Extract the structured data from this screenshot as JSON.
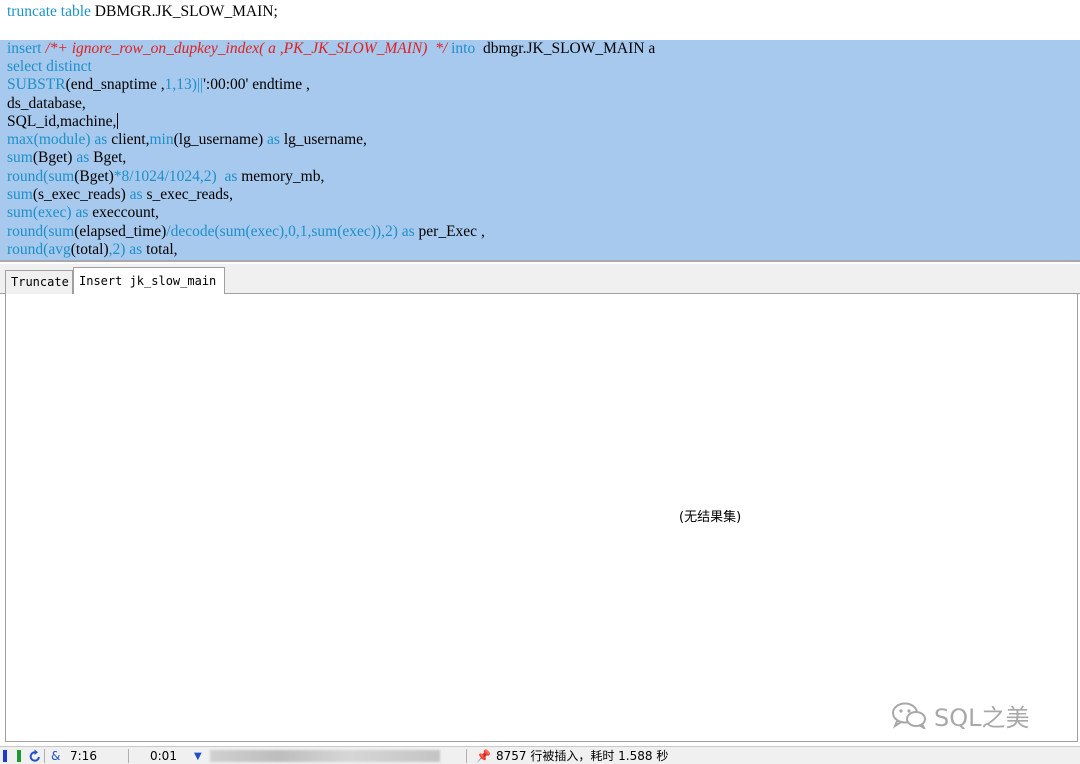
{
  "editor": {
    "line0": {
      "kw": "truncate table",
      "rest": " DBMGR.JK_SLOW_MAIN;"
    },
    "line1": {
      "kw1": "insert",
      "comment": " /*+ ignore_row_on_dupkey_index( a ,PK_JK_SLOW_MAIN)  */",
      "kw2": " into",
      "rest": "  dbmgr.JK_SLOW_MAIN a"
    },
    "line2": {
      "kw": "select distinct"
    },
    "line3": {
      "f": "SUBSTR",
      "a": "(end_snaptime ,",
      "n": "1,13)||",
      "s": "':00:00'",
      "rest": " endtime ,"
    },
    "line4": {
      "text": "ds_database,"
    },
    "line5": {
      "text": "SQL_id,machine,"
    },
    "line6": {
      "f1": "max(module)",
      "as1": " as",
      "t1": " client,",
      "f2": "min",
      "t2": "(lg_username)",
      "as2": " as",
      "t3": " lg_username,"
    },
    "line7": {
      "f": "sum",
      "t1": "(Bget)",
      "as": " as",
      "t2": " Bget,"
    },
    "line8": {
      "f": "round",
      "p": "(",
      "f2": "sum",
      "t1": "(Bget)",
      "n": "*8/1024/1024,2)",
      "as": "  as",
      "t2": " memory_mb,"
    },
    "line9": {
      "f": "sum",
      "t1": "(s_exec_reads)",
      "as": " as",
      "t2": " s_exec_reads,"
    },
    "line10": {
      "f": "sum(exec)",
      "as": " as",
      "t2": " execcount,"
    },
    "line11": {
      "f": "round",
      "p": "(",
      "f2": "sum",
      "t1": "(elapsed_time)",
      "f3": "/decode",
      "p2": "(",
      "f4": "sum(exec)",
      "n": ",0,1,",
      "f5": "sum(exec)",
      "n2": "),2)",
      "as": " as",
      "t2": " per_Exec ,"
    },
    "line12": {
      "f": "round",
      "p": "(",
      "f2": "avg",
      "t1": "(total)",
      "n": ",2)",
      "as": " as",
      "t2": " total,"
    }
  },
  "tabs": [
    {
      "label": "Truncate"
    },
    {
      "label": "Insert jk_slow_main"
    }
  ],
  "results": {
    "empty_text": "(无结果集)"
  },
  "watermark": {
    "text": "SQL之美"
  },
  "status": {
    "position": "7:16",
    "elapsed": "0:01",
    "message": "8757 行被插入，耗时 1.588 秒"
  },
  "colors": {
    "selection": "#a7c9ee",
    "keyword": "#1e90c8",
    "comment": "#e02020"
  }
}
